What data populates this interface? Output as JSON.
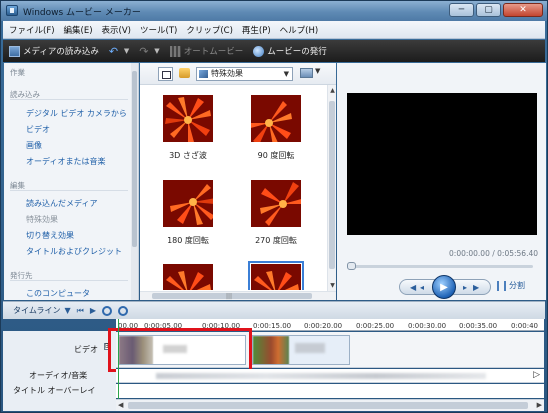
{
  "window": {
    "title": "Windows ムービー メーカー"
  },
  "window_buttons": {
    "minimize": "─",
    "maximize": "▢",
    "close": "✕"
  },
  "menu": [
    "ファイル(F)",
    "編集(E)",
    "表示(V)",
    "ツール(T)",
    "クリップ(C)",
    "再生(P)",
    "ヘルプ(H)"
  ],
  "toolbar": {
    "import": "メディアの読み込み",
    "automovie": "オートムービー",
    "publish": "ムービーの発行"
  },
  "tasks": {
    "header": "作業",
    "import_section": "読み込み",
    "import_items": [
      "デジタル ビデオ カメラから",
      "ビデオ",
      "画像",
      "オーディオまたは音楽"
    ],
    "edit_section": "編集",
    "edit_items": [
      "読み込んだメディア",
      "特殊効果",
      "切り替え効果",
      "タイトルおよびクレジット"
    ],
    "publish_section": "発行先",
    "publish_items": [
      "このコンピュータ"
    ]
  },
  "content": {
    "dropdown_value": "特殊効果",
    "effects": [
      {
        "label": "3D さざ波",
        "style": "ripple"
      },
      {
        "label": "90 度回転",
        "style": "rot90"
      },
      {
        "label": "180 度回転",
        "style": "rot180"
      },
      {
        "label": "270 度回転",
        "style": "rot270"
      },
      {
        "label": "",
        "style": "normal"
      },
      {
        "label": "",
        "style": "selected"
      }
    ]
  },
  "preview": {
    "time": "0:00:00.00 / 0:05:56.40",
    "split": "分割"
  },
  "timeline": {
    "label": "タイムライン",
    "ruler": [
      "00.00",
      "0:00:05.00",
      "0:00:10.00",
      "0:00:15.00",
      "0:00:20.00",
      "0:00:25.00",
      "0:00:30.00",
      "0:00:35.00",
      "0:00:40"
    ],
    "tracks": {
      "video": "ビデオ",
      "audio": "オーディオ/音楽",
      "title": "タイトル オーバーレイ"
    },
    "expand": "田"
  },
  "colors": {
    "highlight": "#e0121b",
    "link": "#1f5fa8"
  }
}
